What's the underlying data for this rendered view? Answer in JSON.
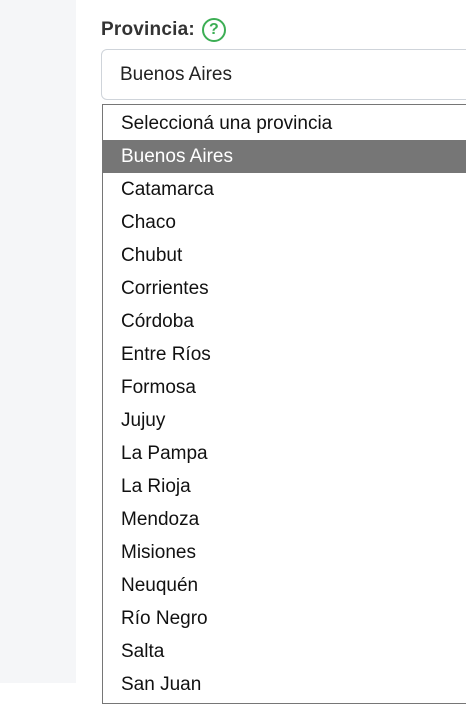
{
  "field": {
    "label": "Provincia:",
    "help_icon": "question-icon",
    "help_glyph": "?",
    "selected_value": "Buenos Aires"
  },
  "dropdown": {
    "selected_index": 1,
    "options": [
      "Seleccioná una provincia",
      "Buenos Aires",
      "Catamarca",
      "Chaco",
      "Chubut",
      "Corrientes",
      "Córdoba",
      "Entre Ríos",
      "Formosa",
      "Jujuy",
      "La Pampa",
      "La Rioja",
      "Mendoza",
      "Misiones",
      "Neuquén",
      "Río Negro",
      "Salta",
      "San Juan"
    ]
  },
  "colors": {
    "help_accent": "#3cae54",
    "selected_option_bg": "#767676",
    "left_panel_bg": "#f5f6f8"
  }
}
